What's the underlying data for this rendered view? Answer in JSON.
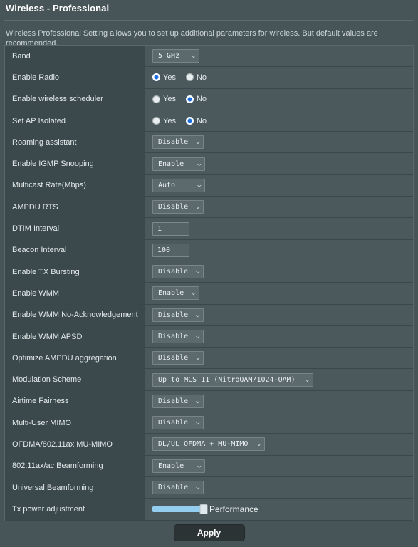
{
  "header": {
    "title": "Wireless - Professional",
    "description": "Wireless Professional Setting allows you to set up additional parameters for wireless. But default values are recommended."
  },
  "colors": {
    "accent_blue": "#1b6fe0",
    "slider_blue": "#93cdf0",
    "label_cell": "#3b484c",
    "value_cell": "#4b595d",
    "page_bg": "#475559"
  },
  "radio": {
    "yes_label": "Yes",
    "no_label": "No"
  },
  "rows": [
    {
      "label": "Band",
      "type": "select",
      "value": "5 GHz",
      "width": "w-sm"
    },
    {
      "label": "Enable Radio",
      "type": "radio",
      "selected": "yes"
    },
    {
      "label": "Enable wireless scheduler",
      "type": "radio",
      "selected": "no"
    },
    {
      "label": "Set AP Isolated",
      "type": "radio",
      "selected": "no"
    },
    {
      "label": "Roaming assistant",
      "type": "select",
      "value": "Disable",
      "width": "w-md"
    },
    {
      "label": "Enable IGMP Snooping",
      "type": "select",
      "value": "Enable",
      "width": "w-lg"
    },
    {
      "label": "Multicast Rate(Mbps)",
      "type": "select",
      "value": "Auto",
      "width": "w-lg"
    },
    {
      "label": "AMPDU RTS",
      "type": "select",
      "value": "Disable",
      "width": "w-md"
    },
    {
      "label": "DTIM Interval",
      "type": "text",
      "value": "1"
    },
    {
      "label": "Beacon Interval",
      "type": "text",
      "value": "100"
    },
    {
      "label": "Enable TX Bursting",
      "type": "select",
      "value": "Disable",
      "width": "w-md"
    },
    {
      "label": "Enable WMM",
      "type": "select",
      "value": "Enable",
      "width": "w-sm"
    },
    {
      "label": "Enable WMM No-Acknowledgement",
      "type": "select",
      "value": "Disable",
      "width": "w-md"
    },
    {
      "label": "Enable WMM APSD",
      "type": "select",
      "value": "Disable",
      "width": "w-md"
    },
    {
      "label": "Optimize AMPDU aggregation",
      "type": "select",
      "value": "Disable",
      "width": "w-md"
    },
    {
      "label": "Modulation Scheme",
      "type": "select",
      "value": "Up to MCS 11 (NitroQAM/1024-QAM)",
      "width": "w-xxl"
    },
    {
      "label": "Airtime Fairness",
      "type": "select",
      "value": "Disable",
      "width": "w-md"
    },
    {
      "label": "Multi-User MIMO",
      "type": "select",
      "value": "Disable",
      "width": "w-md"
    },
    {
      "label": "OFDMA/802.11ax MU-MIMO",
      "type": "select",
      "value": "DL/UL OFDMA + MU-MIMO",
      "width": "w-xl"
    },
    {
      "label": "802.11ax/ac Beamforming",
      "type": "select",
      "value": "Enable",
      "width": "w-lg"
    },
    {
      "label": "Universal Beamforming",
      "type": "select",
      "value": "Disable",
      "width": "w-md"
    },
    {
      "label": "Tx power adjustment",
      "type": "slider",
      "value": "Performance",
      "percent": 100
    }
  ],
  "footer": {
    "apply_label": "Apply"
  }
}
